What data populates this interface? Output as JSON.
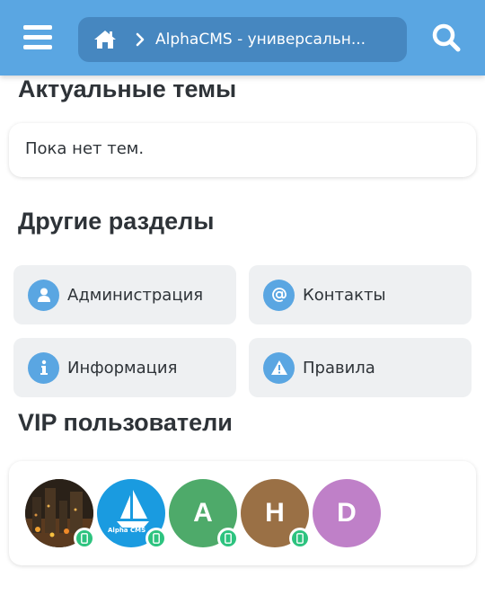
{
  "header": {
    "menu_icon": "hamburger-menu-icon",
    "breadcrumb": {
      "home_icon": "home-icon",
      "separator_icon": "chevron-right-icon",
      "text": "AlphaCMS - универсальн..."
    },
    "search_icon": "search-icon",
    "background_color": "#5aa6e2",
    "breadcrumb_color": "#4687c0"
  },
  "topics": {
    "title": "Актуальные темы",
    "empty_text": "Пока нет тем."
  },
  "sections": {
    "title": "Другие разделы",
    "items": [
      {
        "label": "Администрация",
        "icon": "user-icon"
      },
      {
        "label": "Контакты",
        "icon": "at-icon"
      },
      {
        "label": "Информация",
        "icon": "info-icon"
      },
      {
        "label": "Правила",
        "icon": "warning-icon"
      }
    ]
  },
  "vip": {
    "title": "VIP пользователи",
    "users": [
      {
        "avatar": "city-night-photo",
        "online": true,
        "mobile_icon": "mobile-icon"
      },
      {
        "avatar": "alphacms-logo",
        "logo_text": "Alpha CMS",
        "online": true,
        "mobile_icon": "mobile-icon"
      },
      {
        "letter": "A",
        "color": "#4eaa6a",
        "online": true,
        "mobile_icon": "mobile-icon"
      },
      {
        "letter": "H",
        "color": "#9a7045",
        "online": true,
        "mobile_icon": "mobile-icon"
      },
      {
        "letter": "D",
        "color": "#bf80c8",
        "online": false
      }
    ]
  },
  "colors": {
    "accent": "#5aa6e2",
    "tile_bg": "#eef0f2",
    "online": "#2dc37f"
  }
}
